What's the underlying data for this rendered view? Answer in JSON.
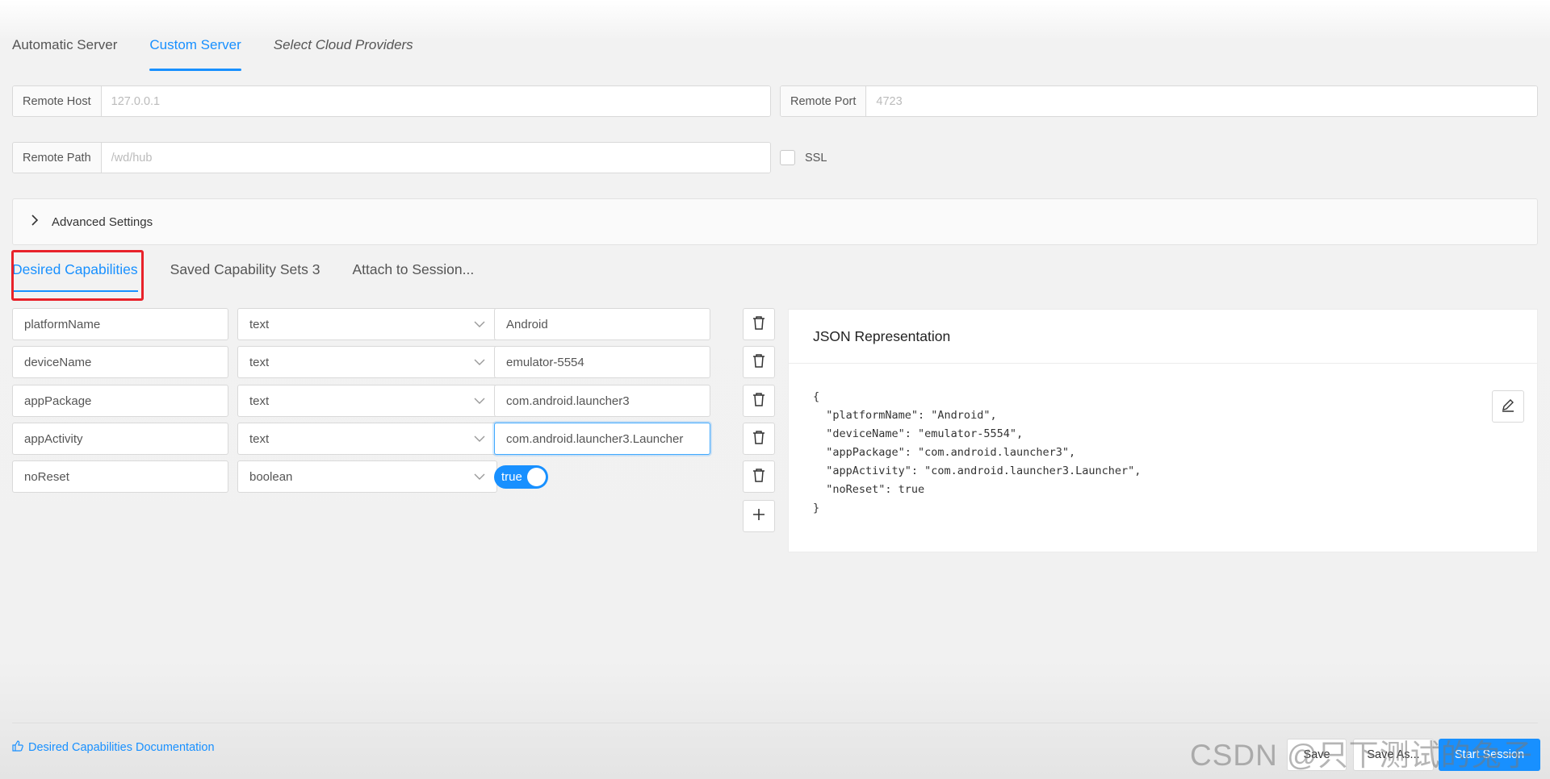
{
  "server_tabs": [
    {
      "label": "Automatic Server"
    },
    {
      "label": "Custom Server",
      "active": true
    },
    {
      "label": "Select Cloud Providers"
    }
  ],
  "remote_host": {
    "label": "Remote Host",
    "placeholder": "127.0.0.1",
    "value": ""
  },
  "remote_port": {
    "label": "Remote Port",
    "placeholder": "4723",
    "value": ""
  },
  "remote_path": {
    "label": "Remote Path",
    "placeholder": "/wd/hub",
    "value": ""
  },
  "ssl": {
    "label": "SSL",
    "checked": false
  },
  "advanced": {
    "label": "Advanced Settings"
  },
  "cap_tabs": [
    {
      "label": "Desired Capabilities",
      "active": true
    },
    {
      "label": "Saved Capability Sets 3"
    },
    {
      "label": "Attach to Session..."
    }
  ],
  "capabilities": [
    {
      "name": "platformName",
      "type": "text",
      "value": "Android"
    },
    {
      "name": "deviceName",
      "type": "text",
      "value": "emulator-5554"
    },
    {
      "name": "appPackage",
      "type": "text",
      "value": "com.android.launcher3"
    },
    {
      "name": "appActivity",
      "type": "text",
      "value": "com.android.launcher3.Launcher"
    },
    {
      "name": "noReset",
      "type": "boolean",
      "value": "true"
    }
  ],
  "json_panel": {
    "title": "JSON Representation",
    "text": "{\n  \"platformName\": \"Android\",\n  \"deviceName\": \"emulator-5554\",\n  \"appPackage\": \"com.android.launcher3\",\n  \"appActivity\": \"com.android.launcher3.Launcher\",\n  \"noReset\": true\n}"
  },
  "footer": {
    "doc_link": "Desired Capabilities Documentation",
    "save": "Save",
    "save_as": "Save As...",
    "start": "Start Session",
    "watermark": "CSDN @只下测试的兔子"
  },
  "colors": {
    "accent": "#1890ff",
    "highlight": "#e8222a"
  }
}
